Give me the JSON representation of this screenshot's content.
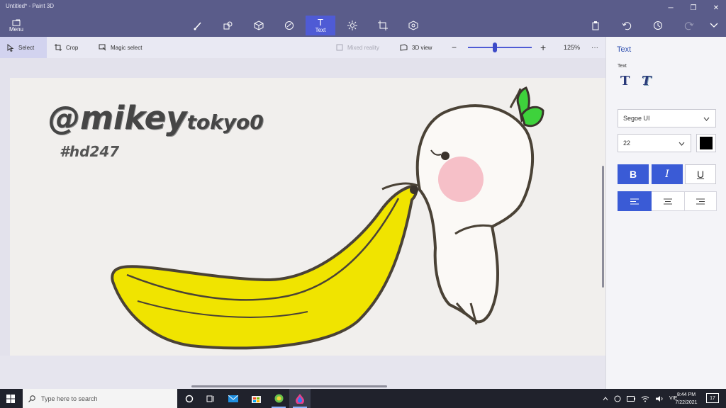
{
  "window": {
    "title": "Untitled* - Paint 3D",
    "menu_label": "Menu",
    "controls": [
      "minimize",
      "maximize",
      "close"
    ]
  },
  "toolbar": {
    "tools": [
      {
        "name": "brushes",
        "icon": "brush-icon"
      },
      {
        "name": "2d-shapes",
        "icon": "shapes-2d-icon"
      },
      {
        "name": "3d-shapes",
        "icon": "cube-icon"
      },
      {
        "name": "stickers",
        "icon": "sticker-icon"
      },
      {
        "name": "text",
        "icon": "text-icon",
        "label": "Text",
        "active": true
      },
      {
        "name": "effects",
        "icon": "sun-icon"
      },
      {
        "name": "canvas",
        "icon": "crop-canvas-icon"
      },
      {
        "name": "3d-library",
        "icon": "library-icon"
      }
    ],
    "right_icons": [
      "paste-icon",
      "undo-icon",
      "history-icon",
      "redo-icon",
      "expand-icon"
    ]
  },
  "subbar": {
    "select": "Select",
    "crop": "Crop",
    "magic_select": "Magic select",
    "mixed_reality": "Mixed reality",
    "view_3d": "3D view",
    "zoom": "125%",
    "zoom_level": 0.42,
    "more": "···"
  },
  "canvas_text": {
    "handle": "@mikey",
    "handle_small": "tokyo0",
    "hashtag": "#hd247"
  },
  "panel": {
    "title": "Text",
    "text_section": "Text",
    "font": "Segoe UI",
    "size": "22",
    "color": "#000000",
    "bold": "B",
    "italic": "I",
    "underline": "U",
    "accent": "#3a5bd6"
  },
  "taskbar": {
    "search_placeholder": "Type here to search",
    "language": "VIE",
    "time": "8:44 PM",
    "date": "7/22/2021",
    "notifications": "17"
  }
}
